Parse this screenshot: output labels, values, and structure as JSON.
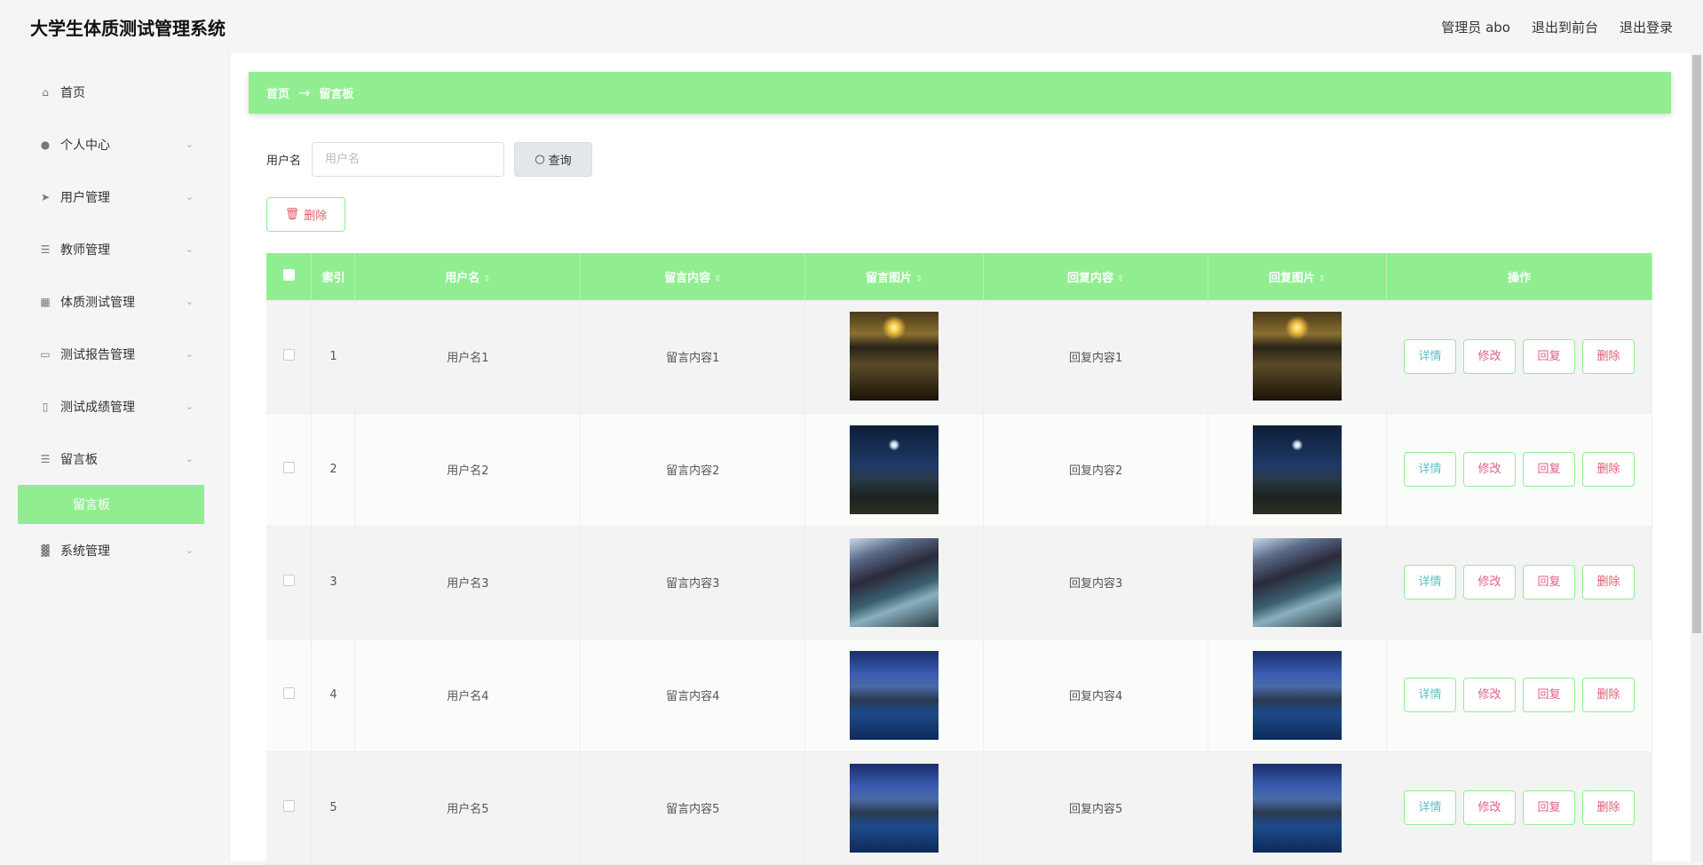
{
  "header": {
    "title": "大学生体质测试管理系统",
    "user": "管理员 abo",
    "to_front": "退出到前台",
    "logout": "退出登录"
  },
  "sidebar": {
    "items": [
      {
        "label": "首页",
        "icon": "home-icon"
      },
      {
        "label": "个人中心",
        "icon": "user-icon"
      },
      {
        "label": "用户管理",
        "icon": "send-icon"
      },
      {
        "label": "教师管理",
        "icon": "list-icon"
      },
      {
        "label": "体质测试管理",
        "icon": "grid-icon"
      },
      {
        "label": "测试报告管理",
        "icon": "monitor-icon"
      },
      {
        "label": "测试成绩管理",
        "icon": "clipboard-icon"
      },
      {
        "label": "留言板",
        "icon": "list-icon"
      }
    ],
    "active_sub": "留言板",
    "last": {
      "label": "系统管理",
      "icon": "chart-icon"
    }
  },
  "breadcrumb": {
    "home": "首页",
    "arrow": "→",
    "current": "留言板"
  },
  "search": {
    "label": "用户名",
    "placeholder": "用户名",
    "value": "",
    "button": "查询"
  },
  "delete_button": "删除",
  "table": {
    "headers": [
      "索引",
      "用户名",
      "留言内容",
      "留言图片",
      "回复内容",
      "回复图片",
      "操作"
    ],
    "actions": [
      "详情",
      "修改",
      "回复",
      "删除"
    ],
    "action_colors": [
      "#5bbfc8",
      "#e0608a",
      "#e0608a",
      "#e06070"
    ],
    "rows": [
      {
        "index": "1",
        "username": "用户名1",
        "content": "留言内容1",
        "reply": "回复内容1",
        "image": "sunset-beach"
      },
      {
        "index": "2",
        "username": "用户名2",
        "content": "留言内容2",
        "reply": "回复内容2",
        "image": "night-valley"
      },
      {
        "index": "3",
        "username": "用户名3",
        "content": "留言内容3",
        "reply": "回复内容3",
        "image": "mountain-river"
      },
      {
        "index": "4",
        "username": "用户名4",
        "content": "留言内容4",
        "reply": "回复内容4",
        "image": "blue-lake"
      },
      {
        "index": "5",
        "username": "用户名5",
        "content": "留言内容5",
        "reply": "回复内容5",
        "image": "blue-lake"
      }
    ]
  }
}
